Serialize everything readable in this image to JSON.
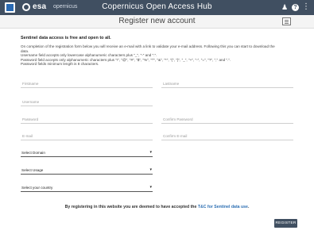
{
  "header": {
    "esa_text": "esa",
    "copernicus_text": "opernicus",
    "title": "Copernicus Open Access Hub",
    "user_icon": "user-plus-icon",
    "help_icon": "help-icon",
    "help_glyph": "?",
    "menu_icon": "menu-icon"
  },
  "subheader": {
    "title": "Register new account",
    "doc_icon": "document-icon"
  },
  "intro": {
    "bold": "Sentinel data access is free and open to all.",
    "line1": "On completion of the registration form below you will receive an e-mail with a link to validate your e-mail address. Following this you can start to download the",
    "line2": "data.",
    "line3": "Username field accepts only lowercase alphanumeric characters plus \"_\", \"-\" and \".\".",
    "line4": "Password field accepts only alphanumeric characters plus \"!\", \"@\", \"#\", \"$\", \"%\", \"^\", \"&\", \"*\", \"(\", \")\", \"_\", \"+\", \"-\", \"=\", \"?\", \",\" and \".\".",
    "line5": "Password fields minimum length is 8 characters."
  },
  "form": {
    "firstname": "Firstname",
    "lastname": "Lastname",
    "username": "Username",
    "password": "Password",
    "confirm_password": "Confirm Password",
    "email": "E-mail",
    "confirm_email": "Confirm E-mail",
    "domain": "Select Domain",
    "usage": "Select Usage",
    "country": "Select your country",
    "caret": "▾"
  },
  "terms": {
    "prefix": "By registering in this website you are deemed to have accepted the ",
    "link": "T&C for Sentinel data use",
    "suffix": "."
  },
  "register_button": "REGISTER"
}
